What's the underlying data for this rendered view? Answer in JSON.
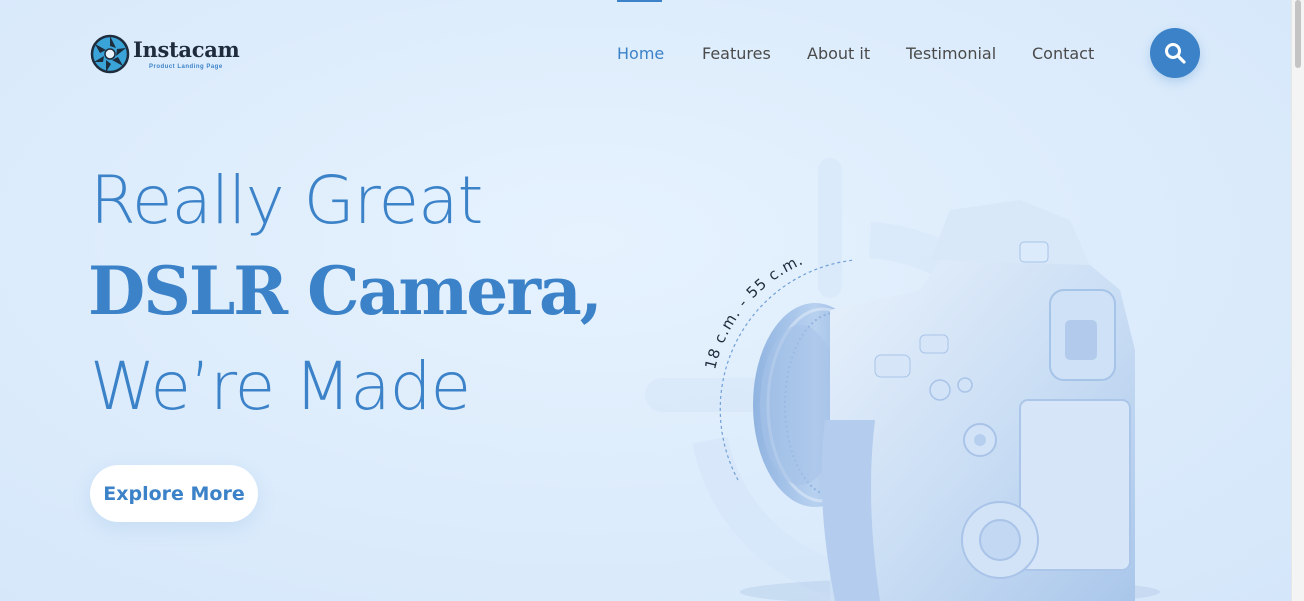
{
  "brand": {
    "name": "Instacam",
    "tagline": "Product Landing Page"
  },
  "nav": {
    "items": [
      {
        "label": "Home",
        "active": true
      },
      {
        "label": "Features",
        "active": false
      },
      {
        "label": "About it",
        "active": false
      },
      {
        "label": "Testimonial",
        "active": false
      },
      {
        "label": "Contact",
        "active": false
      }
    ],
    "search_icon": "search-icon"
  },
  "hero": {
    "line1": "Really Great",
    "line2": "DSLR Camera,",
    "line3": "We’re Made",
    "cta_label": "Explore More"
  },
  "product": {
    "lens_range": "18 c.m. - 55 c.m."
  },
  "colors": {
    "accent": "#3b82c8",
    "background": "#deedfc",
    "text_dark": "#4a4a4a",
    "camera": "#bcd6f2"
  }
}
